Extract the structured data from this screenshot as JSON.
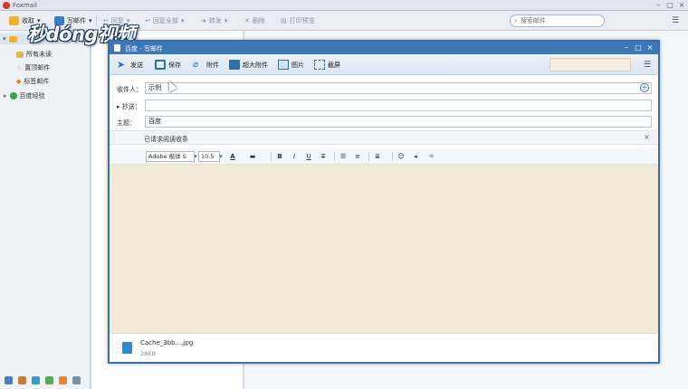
{
  "app": {
    "title": "Foxmail"
  },
  "main_toolbar": {
    "receive": "收取",
    "compose": "写邮件",
    "reply": "回复",
    "reply_all": "回复全部",
    "forward": "转发",
    "delete": "删除",
    "print_preview": "打印预览",
    "search_placeholder": "搜索邮件"
  },
  "sidebar": {
    "items": [
      {
        "label": "所有未读"
      },
      {
        "label": "置顶邮件"
      },
      {
        "label": "标签邮件"
      },
      {
        "label": "百度经验"
      }
    ]
  },
  "watermark": "秒dóng视频",
  "compose": {
    "window_title": "百度 - 写邮件",
    "toolbar": {
      "send": "发送",
      "save": "保存",
      "attach": "附件",
      "super_attach": "超大附件",
      "image": "图片",
      "screenshot": "截屏"
    },
    "to_label": "收件人：",
    "to_value": "示例",
    "cc_label": "抄送：",
    "cc_value": "",
    "subject_label": "主题：",
    "subject_value": "百度",
    "read_receipt": "已请求阅读收条",
    "format": {
      "font": "Adobe 楷体 S",
      "size": "10.5"
    },
    "attachment": {
      "name": "Cache_3bb....jpg",
      "size": "28KB"
    }
  },
  "colors": {
    "accent": "#3c78b6",
    "editor_bg": "#f2e9d6"
  }
}
